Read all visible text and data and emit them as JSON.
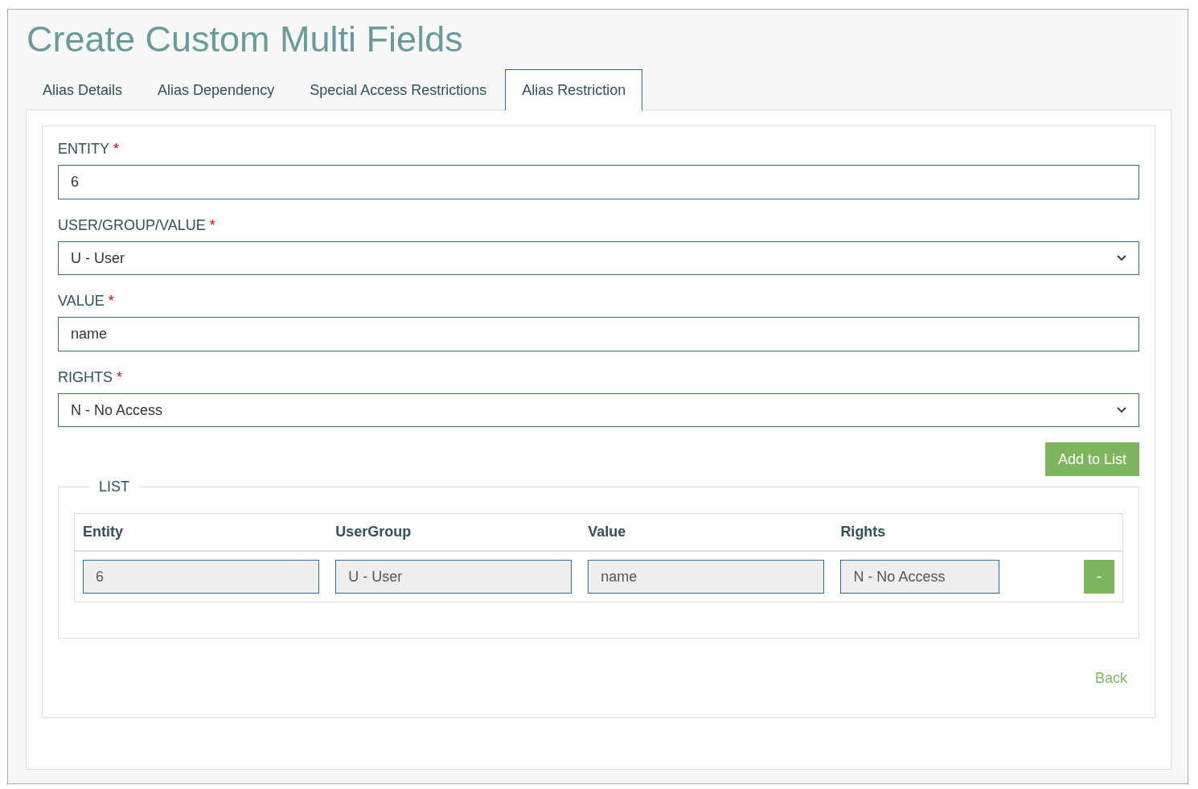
{
  "title": "Create Custom Multi Fields",
  "tabs": [
    {
      "label": "Alias Details",
      "selected": false
    },
    {
      "label": "Alias Dependency",
      "selected": false
    },
    {
      "label": "Special Access Restrictions",
      "selected": false
    },
    {
      "label": "Alias Restriction",
      "selected": true
    }
  ],
  "fields": [
    {
      "label": "ENTITY",
      "required_mark": "*",
      "kind": "text",
      "value": "6"
    },
    {
      "label": "USER/GROUP/VALUE",
      "required_mark": "*",
      "kind": "select",
      "value": "U - User"
    },
    {
      "label": "VALUE",
      "required_mark": "*",
      "kind": "text",
      "value": "name"
    },
    {
      "label": "RIGHTS",
      "required_mark": "*",
      "kind": "select",
      "value": "N - No Access"
    }
  ],
  "add_button": "Add to List",
  "list": {
    "legend": "LIST",
    "columns": [
      "Entity",
      "UserGroup",
      "Value",
      "Rights"
    ],
    "rows": [
      {
        "cells": [
          "6",
          "U - User",
          "name",
          "N - No Access"
        ],
        "remove": "-"
      }
    ]
  },
  "back_link": "Back"
}
